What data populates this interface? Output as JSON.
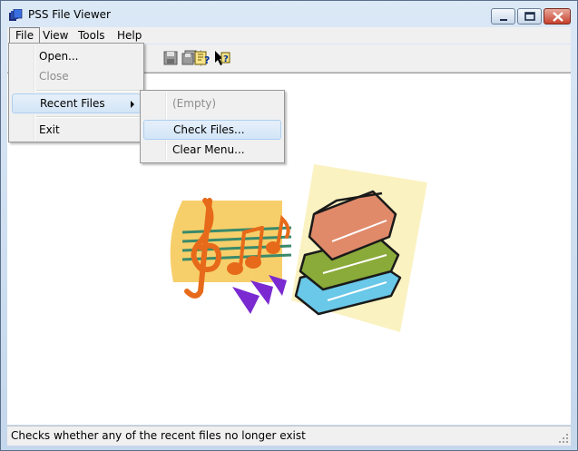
{
  "window": {
    "title": "PSS File Viewer",
    "app_icon": "pss-app-icon",
    "controls": [
      "minimize",
      "maximize",
      "close"
    ]
  },
  "menubar": {
    "items": [
      {
        "label": "File"
      },
      {
        "label": "View"
      },
      {
        "label": "Tools"
      },
      {
        "label": "Help"
      }
    ]
  },
  "file_menu": {
    "items": [
      {
        "label": "Open...",
        "state": "enabled"
      },
      {
        "label": "Close",
        "state": "disabled"
      },
      {
        "label": "Recent Files",
        "state": "highlighted",
        "has_submenu": true
      },
      {
        "label": "Exit",
        "state": "enabled"
      }
    ]
  },
  "recent_files_menu": {
    "items": [
      {
        "label": "(Empty)",
        "state": "disabled"
      },
      {
        "label": "Check Files...",
        "state": "highlighted"
      },
      {
        "label": "Clear Menu...",
        "state": "enabled"
      }
    ]
  },
  "toolbar": {
    "buttons": [
      "save-icon",
      "save-all-icon",
      "help-icon",
      "context-help-icon"
    ]
  },
  "statusbar": {
    "text": "Checks whether any of the recent files no longer exist"
  },
  "content": {
    "image": "music-and-books-clipart"
  }
}
